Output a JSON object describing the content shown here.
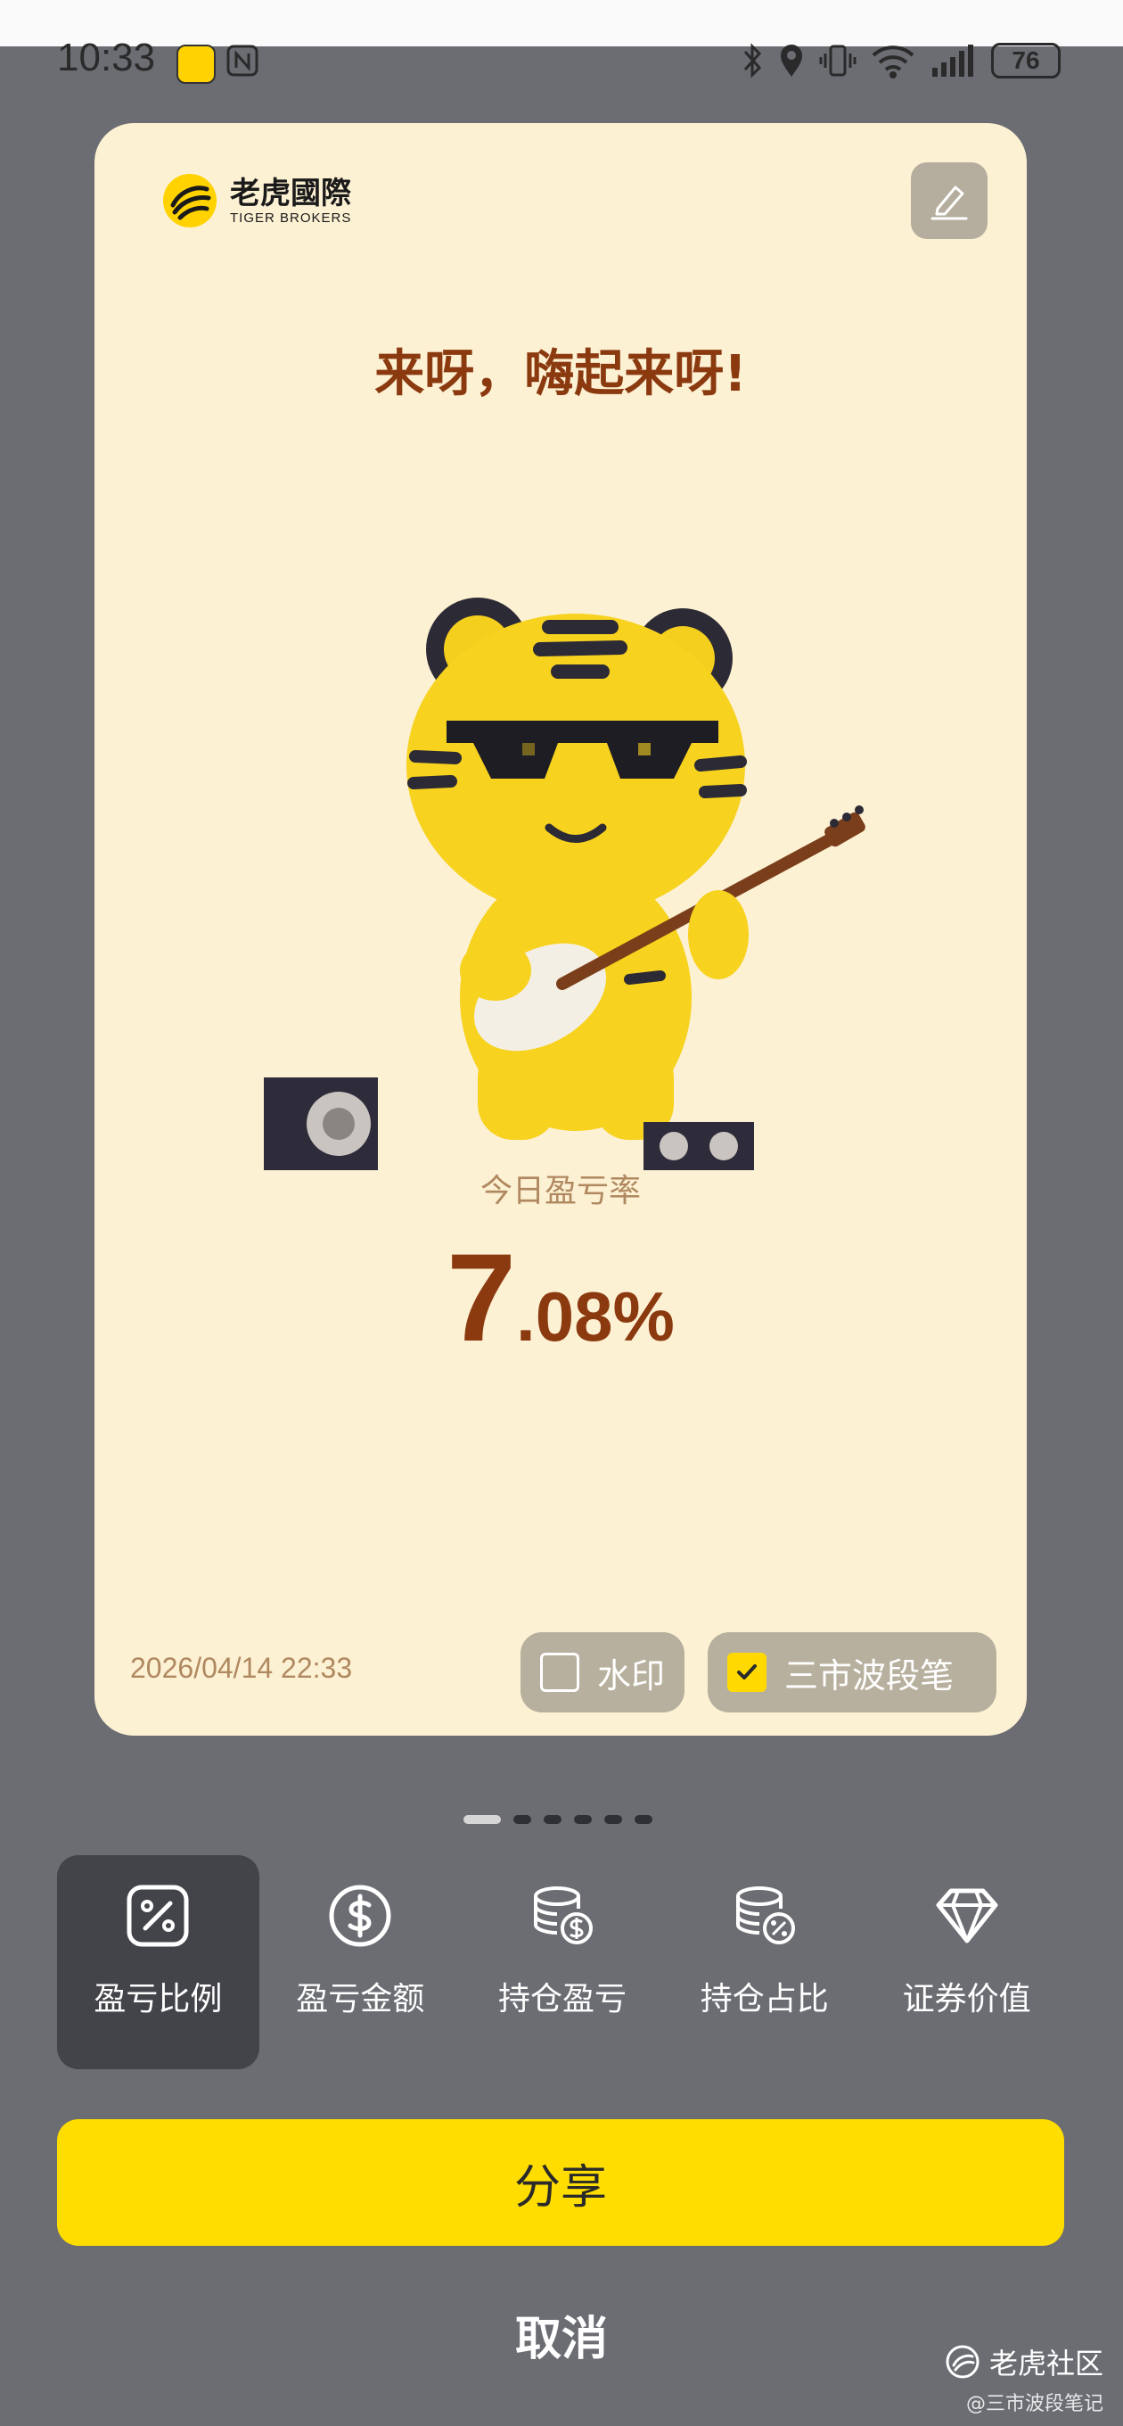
{
  "status_bar": {
    "time": "10:33",
    "battery": "76"
  },
  "card": {
    "brand_cn": "老虎國際",
    "brand_en": "TIGER BROKERS",
    "headline": "来呀，嗨起来呀!",
    "metric_label": "今日盈亏率",
    "metric_int": "7",
    "metric_frac": ".08%",
    "timestamp": "2026/04/14 22:33",
    "options": [
      {
        "label": "水印",
        "checked": false
      },
      {
        "label": "三市波段笔",
        "checked": true
      }
    ]
  },
  "carousel": {
    "pages": 6,
    "active": 0
  },
  "tabs": [
    {
      "label": "盈亏比例",
      "icon": "percent-icon",
      "active": true
    },
    {
      "label": "盈亏金额",
      "icon": "dollar-icon",
      "active": false
    },
    {
      "label": "持仓盈亏",
      "icon": "coins-dollar-icon",
      "active": false
    },
    {
      "label": "持仓占比",
      "icon": "coins-percent-icon",
      "active": false
    },
    {
      "label": "证券价值",
      "icon": "diamond-icon",
      "active": false
    }
  ],
  "actions": {
    "share": "分享",
    "cancel": "取消"
  },
  "watermark": {
    "community": "老虎社区",
    "handle": "@三市波段笔记"
  },
  "colors": {
    "accent": "#ffdd00",
    "card_bg": "#fdf1d3",
    "headline": "#8b3a10"
  }
}
